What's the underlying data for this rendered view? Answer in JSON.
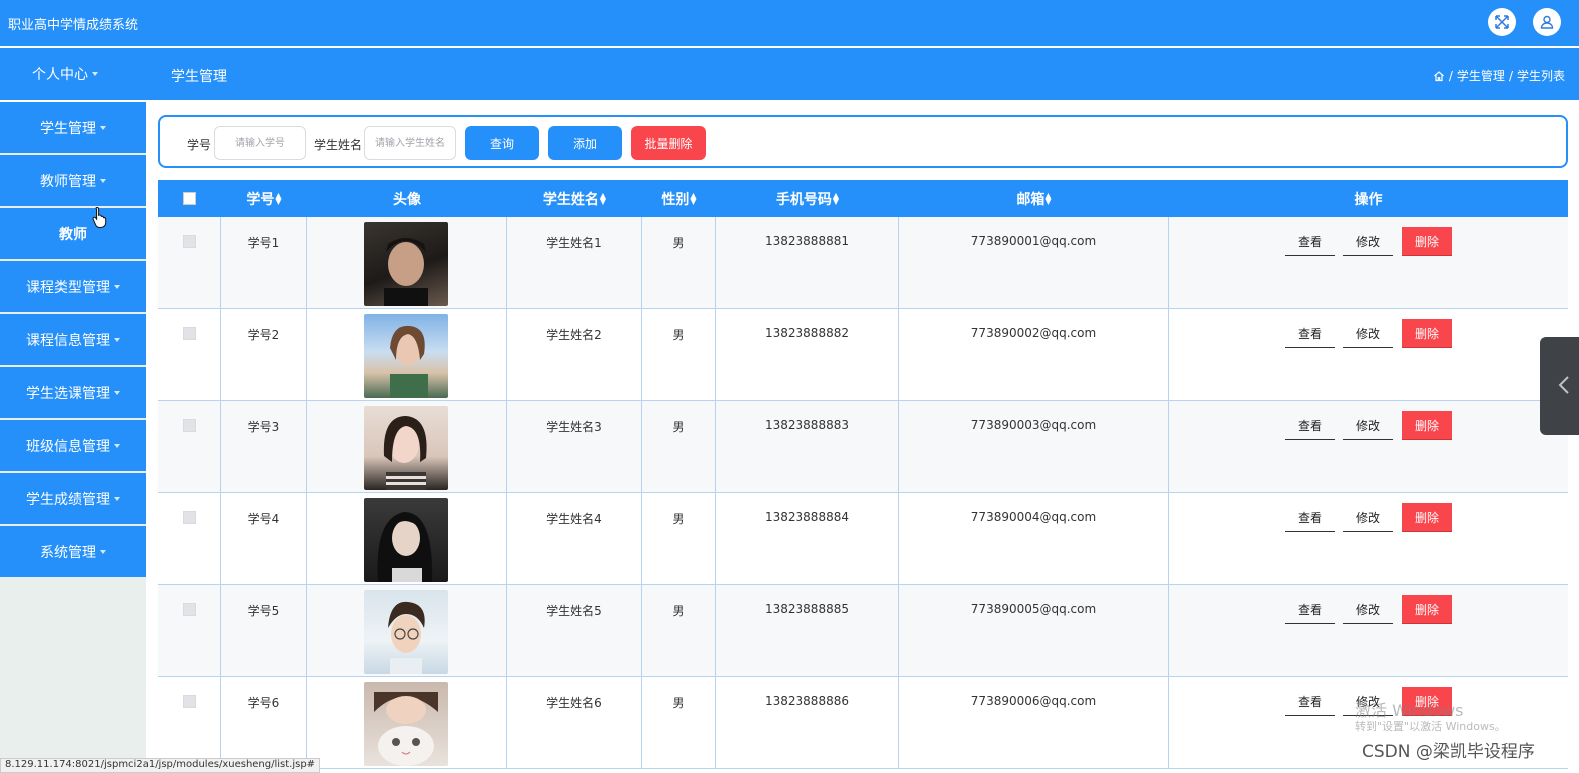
{
  "header": {
    "title": "职业高中学情成绩系统"
  },
  "nav": {
    "user_center": "个人中心",
    "page_title": "学生管理",
    "breadcrumb": [
      "学生管理",
      "学生列表"
    ]
  },
  "sidebar": {
    "items": [
      {
        "label": "学生管理",
        "has_caret": true
      },
      {
        "label": "教师管理",
        "has_caret": true
      },
      {
        "label": "教师",
        "has_caret": false
      },
      {
        "label": "课程类型管理",
        "has_caret": true
      },
      {
        "label": "课程信息管理",
        "has_caret": true
      },
      {
        "label": "学生选课管理",
        "has_caret": true
      },
      {
        "label": "班级信息管理",
        "has_caret": true
      },
      {
        "label": "学生成绩管理",
        "has_caret": true
      },
      {
        "label": "系统管理",
        "has_caret": true
      }
    ]
  },
  "search": {
    "id_label": "学号",
    "id_placeholder": "请输入学号",
    "name_label": "学生姓名",
    "name_placeholder": "请输入学生姓名",
    "query_button": "查询",
    "add_button": "添加",
    "batch_delete_button": "批量删除"
  },
  "table": {
    "columns": [
      "学号",
      "头像",
      "学生姓名",
      "性别",
      "手机号码",
      "邮箱",
      "操作"
    ],
    "rows": [
      {
        "id": "学号1",
        "name": "学生姓名1",
        "gender": "男",
        "phone": "13823888881",
        "email": "773890001@qq.com"
      },
      {
        "id": "学号2",
        "name": "学生姓名2",
        "gender": "男",
        "phone": "13823888882",
        "email": "773890002@qq.com"
      },
      {
        "id": "学号3",
        "name": "学生姓名3",
        "gender": "男",
        "phone": "13823888883",
        "email": "773890003@qq.com"
      },
      {
        "id": "学号4",
        "name": "学生姓名4",
        "gender": "男",
        "phone": "13823888884",
        "email": "773890004@qq.com"
      },
      {
        "id": "学号5",
        "name": "学生姓名5",
        "gender": "男",
        "phone": "13823888885",
        "email": "773890005@qq.com"
      },
      {
        "id": "学号6",
        "name": "学生姓名6",
        "gender": "男",
        "phone": "13823888886",
        "email": "773890006@qq.com"
      }
    ],
    "actions": {
      "view": "查看",
      "edit": "修改",
      "delete": "删除"
    }
  },
  "overlay": {
    "status_url": "8.129.11.174:8021/jspmci2a1/jsp/modules/xuesheng/list.jsp#",
    "activate_line1": "激活 Windows",
    "activate_line2": "转到\"设置\"以激活 Windows。",
    "csdn": "CSDN @梁凯毕设程序"
  },
  "icons": [
    "fullscreen-icon",
    "user-icon",
    "home-icon",
    "collapse-arrow-icon"
  ],
  "colors": {
    "primary": "#2590fa",
    "danger": "#f9454c",
    "sidebar_bg": "#e8efec"
  }
}
